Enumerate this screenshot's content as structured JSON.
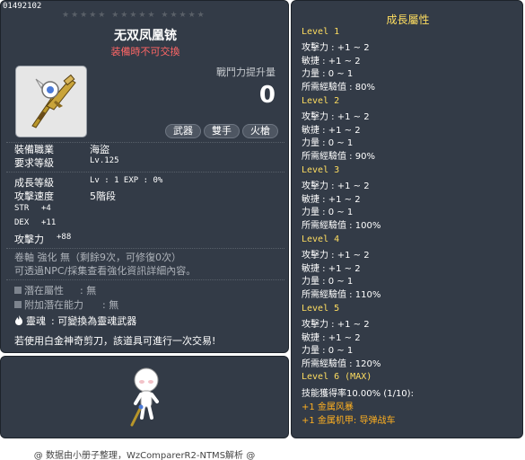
{
  "item": {
    "id": "01492102",
    "stars": "★★★★★  ★★★★★  ★★★★★",
    "name": "无双凤凰铳",
    "trade_note": "装備時不可交換",
    "power_label": "戰鬥力提升量",
    "power_value": "0",
    "tags": [
      "武器",
      "雙手",
      "火槍"
    ],
    "job_label": "裝備職業",
    "job_value": "海盜",
    "req_level_label": "要求等級",
    "req_level_value": "Lv.125",
    "growth_label": "成長等級",
    "growth_value": "Lv : 1   EXP : 0%",
    "attack_speed_label": "攻擊速度",
    "attack_speed_value": "5階段",
    "stats": [
      {
        "label": "STR",
        "value": "+4"
      },
      {
        "label": "DEX",
        "value": "+11"
      },
      {
        "label": "攻擊力",
        "value": "+88"
      }
    ],
    "upgrade_text": "卷軸 強化 無（剩餘9次，可修復0次）",
    "npc_text": "可透過NPC/採集查看強化資訊詳細內容。",
    "potential_label": "潛在屬性",
    "potential_value": ": 無",
    "bonus_potential_label": "附加潛在能力",
    "bonus_potential_value": ": 無",
    "soul_label": "靈魂",
    "soul_value": ": 可變換為靈魂武器",
    "scissors_text": "若使用白金神奇剪刀，該道具可進行一次交易!"
  },
  "growth": {
    "title": "成長屬性",
    "levels": [
      {
        "title": "Level 1",
        "lines": [
          "攻擊力 : +1 ~ 2",
          "敏捷 : +1 ~ 2",
          "力量 : 0 ~ 1",
          "所需經驗值 : 80%"
        ]
      },
      {
        "title": "Level 2",
        "lines": [
          "攻擊力 : +1 ~ 2",
          "敏捷 : +1 ~ 2",
          "力量 : 0 ~ 1",
          "所需經驗值 : 90%"
        ]
      },
      {
        "title": "Level 3",
        "lines": [
          "攻擊力 : +1 ~ 2",
          "敏捷 : +1 ~ 2",
          "力量 : 0 ~ 1",
          "所需經驗值 : 100%"
        ]
      },
      {
        "title": "Level 4",
        "lines": [
          "攻擊力 : +1 ~ 2",
          "敏捷 : +1 ~ 2",
          "力量 : 0 ~ 1",
          "所需經驗值 : 110%"
        ]
      },
      {
        "title": "Level 5",
        "lines": [
          "攻擊力 : +1 ~ 2",
          "敏捷 : +1 ~ 2",
          "力量 : 0 ~ 1",
          "所需經驗值 : 120%"
        ]
      }
    ],
    "max_title": "Level 6 (MAX)",
    "max_line": "技能獲得率10.00% (1/10):",
    "bonus_lines": [
      "+1 金属风暴",
      "+1 金属机甲: 导弹战车"
    ]
  },
  "footer": {
    "credit": "@ 数据由小册子整理，WzComparerR2-NTMS解析 @"
  },
  "colors": {
    "panel_bg": "#333b47",
    "accent_yellow": "#ffde60",
    "warning_red": "#ff6666",
    "bonus_orange": "#ffb020"
  }
}
